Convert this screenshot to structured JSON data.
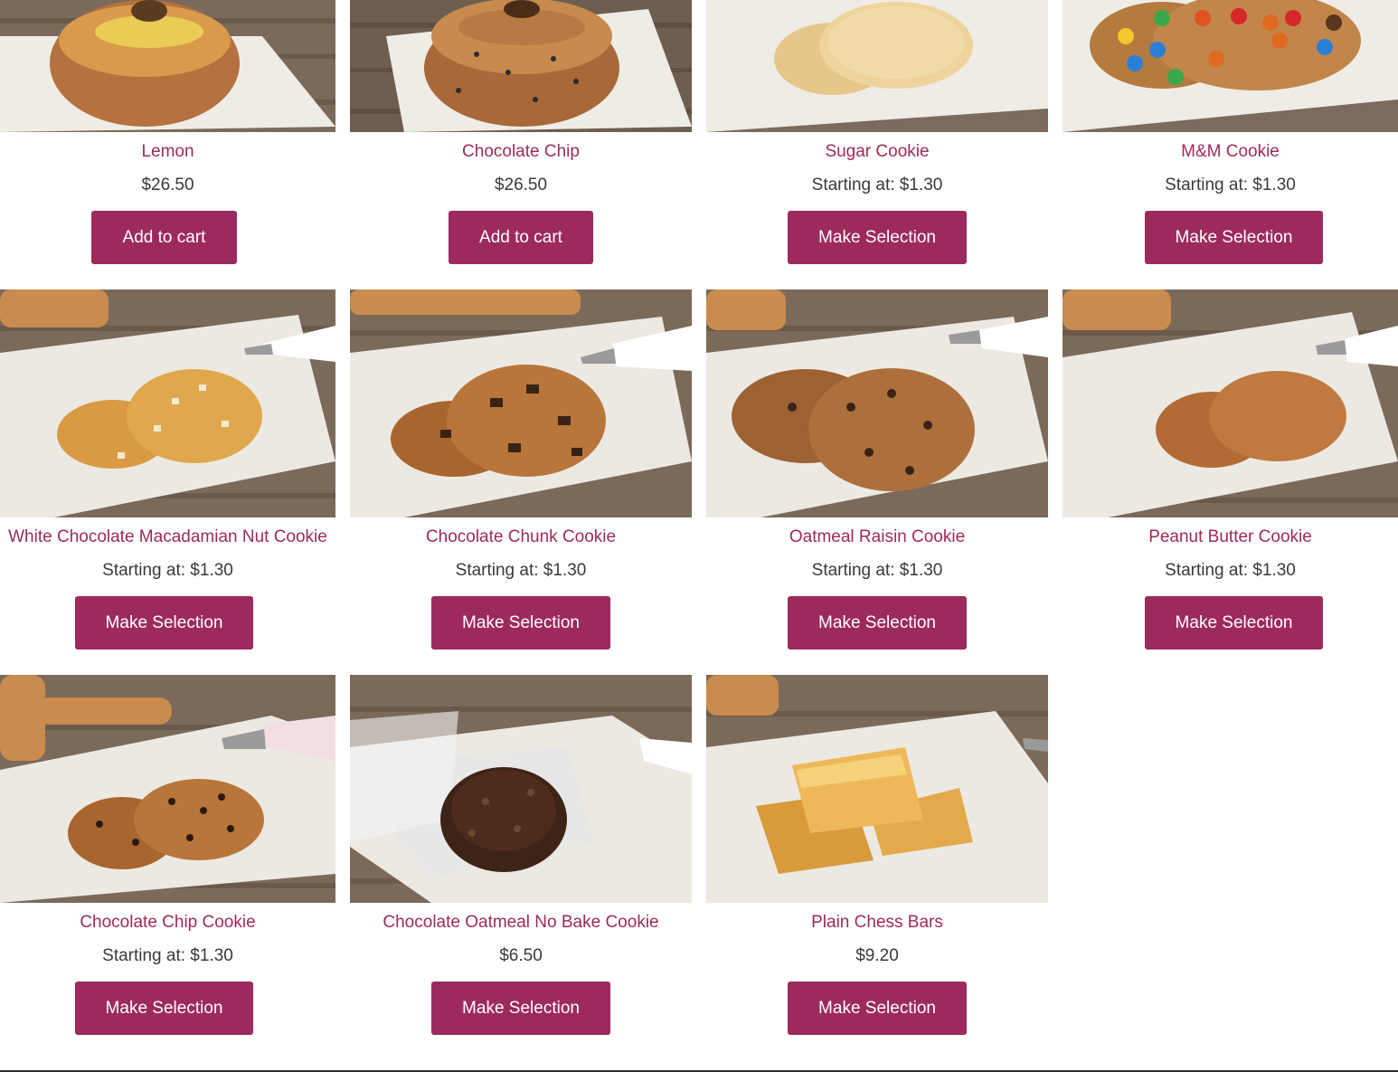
{
  "colors": {
    "accent": "#9d2a5c",
    "price_text": "#3a3a3a",
    "button_text": "#ffffff"
  },
  "products": [
    {
      "title": "Lemon",
      "price": "$26.50",
      "button": "Add to cart",
      "image": "lemon-bundt-cake-photo"
    },
    {
      "title": "Chocolate Chip",
      "price": "$26.50",
      "button": "Add to cart",
      "image": "chocolate-chip-bundt-cake-photo"
    },
    {
      "title": "Sugar Cookie",
      "price": "Starting at: $1.30",
      "button": "Make Selection",
      "image": "sugar-cookie-photo"
    },
    {
      "title": "M&M Cookie",
      "price": "Starting at: $1.30",
      "button": "Make Selection",
      "image": "mm-cookie-photo"
    },
    {
      "title": "White Chocolate Macadamian Nut Cookie",
      "price": "Starting at: $1.30",
      "button": "Make Selection",
      "image": "white-chocolate-macadamia-cookie-photo"
    },
    {
      "title": "Chocolate Chunk Cookie",
      "price": "Starting at: $1.30",
      "button": "Make Selection",
      "image": "chocolate-chunk-cookie-photo"
    },
    {
      "title": "Oatmeal Raisin Cookie",
      "price": "Starting at: $1.30",
      "button": "Make Selection",
      "image": "oatmeal-raisin-cookie-photo"
    },
    {
      "title": "Peanut Butter Cookie",
      "price": "Starting at: $1.30",
      "button": "Make Selection",
      "image": "peanut-butter-cookie-photo"
    },
    {
      "title": "Chocolate Chip Cookie",
      "price": "Starting at: $1.30",
      "button": "Make Selection",
      "image": "chocolate-chip-cookie-photo"
    },
    {
      "title": "Chocolate Oatmeal No Bake Cookie",
      "price": "$6.50",
      "button": "Make Selection",
      "image": "chocolate-oatmeal-no-bake-cookie-photo"
    },
    {
      "title": "Plain Chess Bars",
      "price": "$9.20",
      "button": "Make Selection",
      "image": "plain-chess-bars-photo"
    }
  ]
}
